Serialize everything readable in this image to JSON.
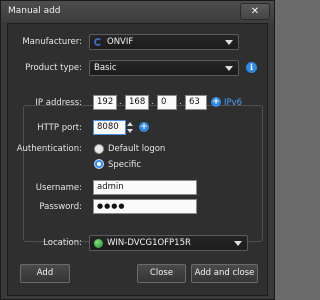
{
  "window": {
    "title": "Manual add",
    "close_glyph": "✕"
  },
  "manufacturer": {
    "label": "Manufacturer:",
    "value": "ONVIF",
    "icon": "onvif-logo-icon"
  },
  "product_type": {
    "label": "Product type:",
    "value": "Basic",
    "info_glyph": "i"
  },
  "ip": {
    "label": "IP address:",
    "octets": [
      "192",
      "168",
      "0",
      "63"
    ],
    "dot": ".",
    "ipv6_link": "IPv6",
    "add_glyph": "+"
  },
  "http_port": {
    "label": "HTTP port:",
    "value": "8080",
    "add_glyph": "+"
  },
  "authentication": {
    "label": "Authentication:",
    "options": [
      {
        "label": "Default logon",
        "selected": false
      },
      {
        "label": "Specific",
        "selected": true
      }
    ]
  },
  "username": {
    "label": "Username:",
    "value": "admin"
  },
  "password": {
    "label": "Password:",
    "masked": "●●●●"
  },
  "location": {
    "label": "Location:",
    "value": "WIN-DVCG1OFP15R",
    "icon": "server-icon"
  },
  "buttons": {
    "add": "Add",
    "close": "Close",
    "add_and_close": "Add and close"
  },
  "colors": {
    "accent": "#2e8ae6",
    "link": "#4aa3ff",
    "background": "#2f2f2f"
  }
}
